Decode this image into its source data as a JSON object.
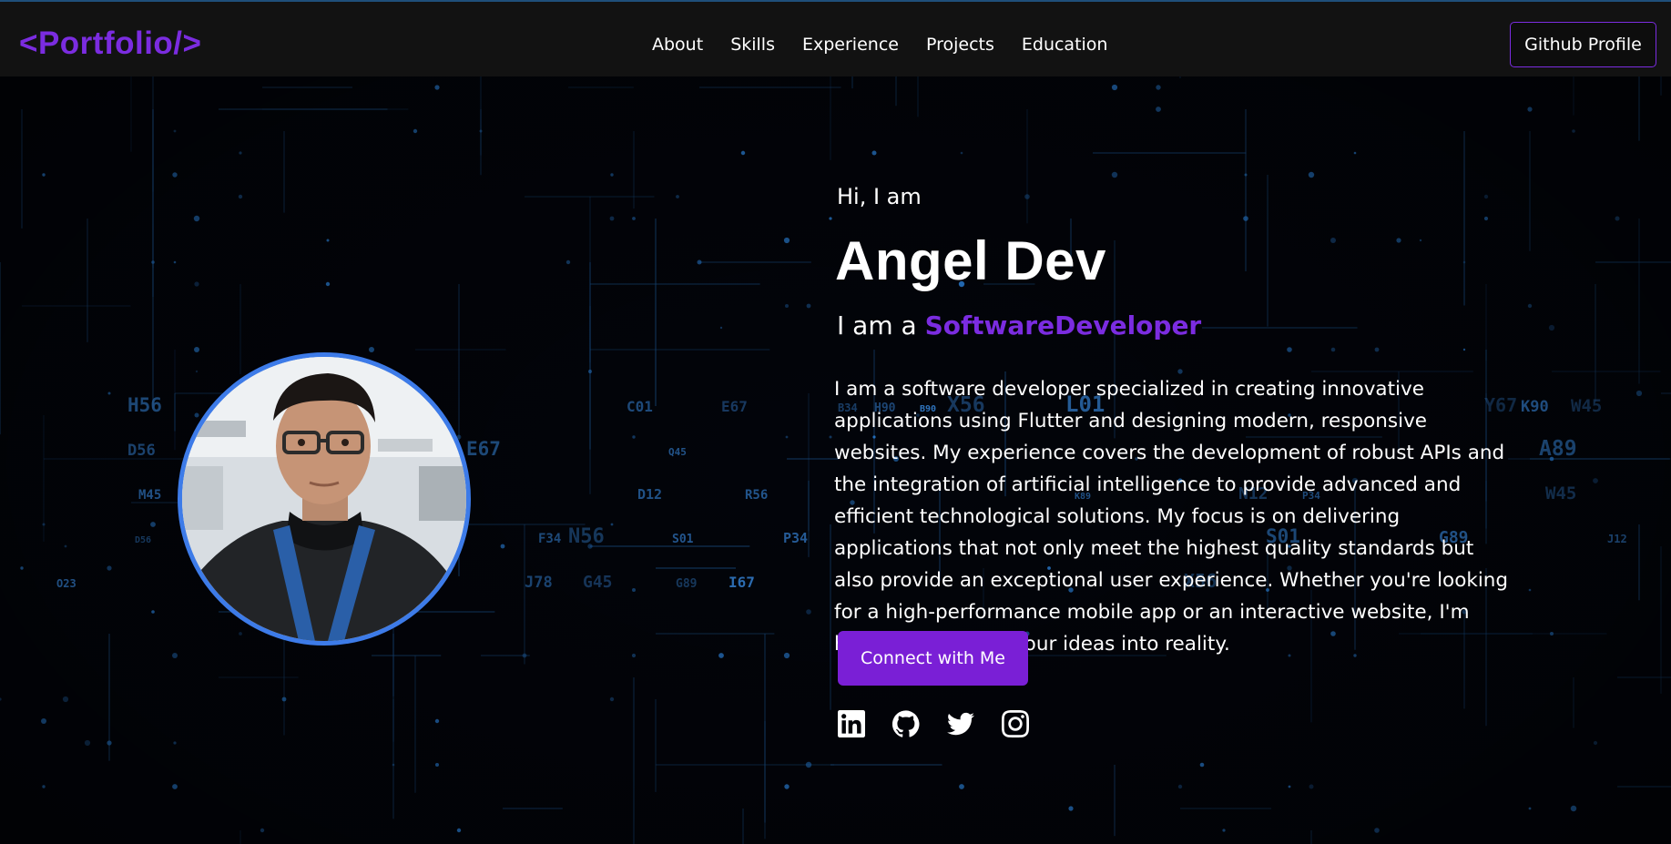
{
  "navbar": {
    "logo": "<Portfolio/>",
    "links": [
      "About",
      "Skills",
      "Experience",
      "Projects",
      "Education"
    ],
    "github_button": "Github Profile"
  },
  "hero": {
    "greeting": "Hi, I am",
    "name": "Angel Dev",
    "role_prefix": "I am a",
    "role_highlight": "SoftwareDeveloper",
    "bio": "I am a software developer specialized in creating innovative applications using Flutter and designing modern, responsive websites. My experience covers the development of robust APIs and the integration of artificial intelligence to provide advanced and efficient technological solutions. My focus is on delivering applications that not only meet the highest quality standards but also provide an exceptional user experience. Whether you're looking for a high-performance mobile app or an interactive website, I'm here to transform your ideas into reality.",
    "connect_button": "Connect with Me",
    "socials": [
      "linkedin-icon",
      "github-icon",
      "twitter-icon",
      "instagram-icon"
    ]
  },
  "background_labels": [
    "D56",
    "E67",
    "D12",
    "R56",
    "F34",
    "N56",
    "G45",
    "I67",
    "O23",
    "H56",
    "M45",
    "J78",
    "S01",
    "Q45",
    "P34",
    "B34",
    "H90",
    "X56",
    "L01",
    "K89",
    "N12",
    "P34",
    "S01",
    "Y67",
    "W45",
    "A89",
    "W45",
    "J12",
    "X56",
    "G89",
    "E67",
    "C01",
    "D56",
    "B90",
    "K90",
    "G89"
  ],
  "colors": {
    "accent": "#7b2ce0",
    "button": "#7a1fd6",
    "avatar_ring": "#3d7be8",
    "navbar": "#121212",
    "background": "#02040a"
  }
}
